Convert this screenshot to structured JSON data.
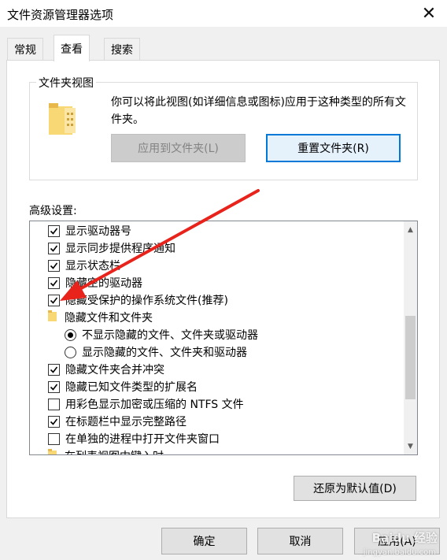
{
  "window": {
    "title": "文件资源管理器选项"
  },
  "tabs": [
    {
      "label": "常规"
    },
    {
      "label": "查看"
    },
    {
      "label": "搜索"
    }
  ],
  "folder_views": {
    "legend": "文件夹视图",
    "description": "你可以将此视图(如详细信息或图标)应用于这种类型的所有文件夹。",
    "apply_button": "应用到文件夹(L)",
    "reset_button": "重置文件夹(R)"
  },
  "advanced": {
    "label": "高级设置:",
    "items": [
      {
        "kind": "checkbox",
        "checked": true,
        "label": "显示驱动器号"
      },
      {
        "kind": "checkbox",
        "checked": true,
        "label": "显示同步提供程序通知"
      },
      {
        "kind": "checkbox",
        "checked": true,
        "label": "显示状态栏"
      },
      {
        "kind": "checkbox",
        "checked": true,
        "label": "隐藏空的驱动器"
      },
      {
        "kind": "checkbox",
        "checked": true,
        "label": "隐藏受保护的操作系统文件(推荐)"
      },
      {
        "kind": "folder",
        "label": "隐藏文件和文件夹"
      },
      {
        "kind": "radio",
        "checked": true,
        "label": "不显示隐藏的文件、文件夹或驱动器"
      },
      {
        "kind": "radio",
        "checked": false,
        "label": "显示隐藏的文件、文件夹和驱动器"
      },
      {
        "kind": "checkbox",
        "checked": true,
        "label": "隐藏文件夹合并冲突"
      },
      {
        "kind": "checkbox",
        "checked": true,
        "label": "隐藏已知文件类型的扩展名"
      },
      {
        "kind": "checkbox",
        "checked": false,
        "label": "用彩色显示加密或压缩的 NTFS 文件"
      },
      {
        "kind": "checkbox",
        "checked": true,
        "label": "在标题栏中显示完整路径"
      },
      {
        "kind": "checkbox",
        "checked": false,
        "label": "在单独的进程中打开文件夹窗口"
      },
      {
        "kind": "folder",
        "label": "在列表视图中键入时"
      }
    ],
    "restore_button": "还原为默认值(D)"
  },
  "footer": {
    "ok": "确定",
    "cancel": "取消",
    "apply": "应用(A)"
  },
  "watermark": {
    "text": "Baidu 经验",
    "sub": "jingyan.baidu.com"
  },
  "colors": {
    "accent": "#0078d7",
    "annotation_arrow": "#e8231b"
  }
}
